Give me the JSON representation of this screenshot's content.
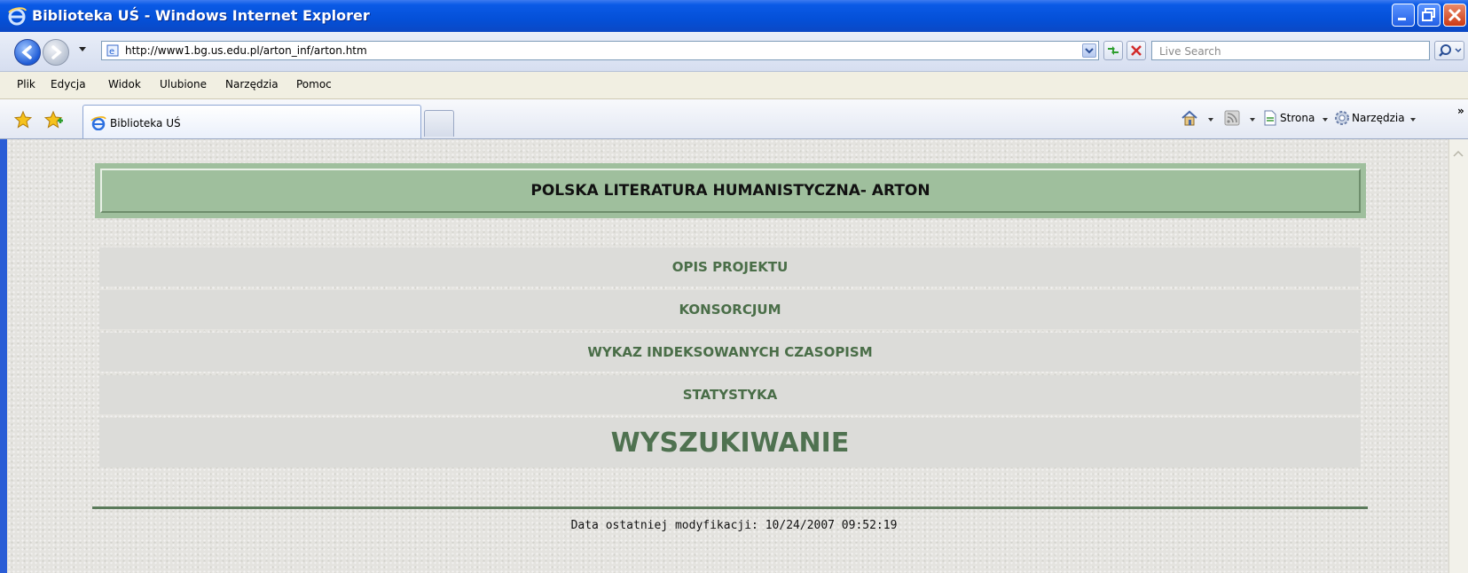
{
  "window": {
    "title": "Biblioteka UŚ - Windows Internet Explorer"
  },
  "address_bar": {
    "url": "http://www1.bg.us.edu.pl/arton_inf/arton.htm",
    "search_placeholder": "Live Search"
  },
  "menu": {
    "items": [
      "Plik",
      "Edycja",
      "Widok",
      "Ulubione",
      "Narzędzia",
      "Pomoc"
    ]
  },
  "tabs": [
    {
      "label": "Biblioteka UŚ"
    }
  ],
  "command_bar": {
    "page_label": "Strona",
    "tools_label": "Narzędzia",
    "overflow": "»"
  },
  "page": {
    "header_title": "POLSKA LITERATURA HUMANISTYCZNA- ARTON",
    "nav_links": [
      "OPIS PROJEKTU",
      "KONSORCJUM",
      "WYKAZ INDEKSOWANYCH CZASOPISM",
      "STATYSTYKA",
      "WYSZUKIWANIE"
    ],
    "footer_text": "Data ostatniej modyfikacji: 10/24/2007 09:52:19"
  },
  "colors": {
    "titlebar_blue": "#0450d8",
    "header_green": "#9fbf9d",
    "link_green": "#4a6e48",
    "rule_green": "#5a7a5a"
  }
}
